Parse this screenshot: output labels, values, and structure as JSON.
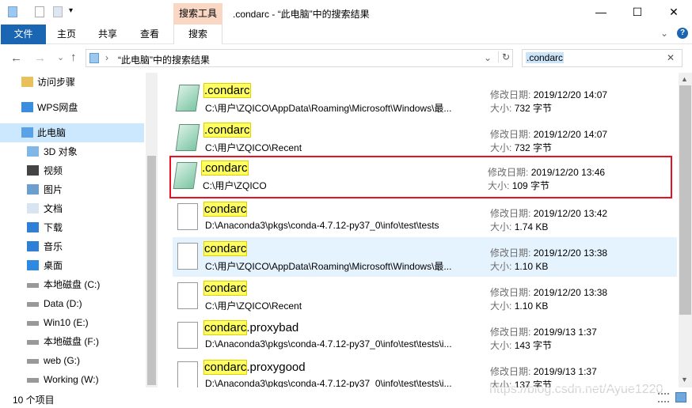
{
  "window": {
    "title": ".condarc - “此电脑”中的搜索结果",
    "context_tab": "搜索工具",
    "minimize": "—",
    "maximize": "☐",
    "close": "✕"
  },
  "ribbon": {
    "tabs": [
      {
        "label": "文件"
      },
      {
        "label": "主页"
      },
      {
        "label": "共享"
      },
      {
        "label": "查看"
      },
      {
        "label": "搜索"
      }
    ],
    "expand": "⌄",
    "help": "?"
  },
  "address": {
    "path": "“此电脑”中的搜索结果",
    "separator": "›",
    "refresh": "↻",
    "dropdown": "⌄"
  },
  "search": {
    "value": ".condarc",
    "clear": "✕"
  },
  "nav": {
    "back": "←",
    "forward": "→",
    "recent": "⌄",
    "up": "↑",
    "items": [
      {
        "label": "访问步骤",
        "icon": "folder-icon"
      },
      {
        "label": "WPS网盘",
        "icon": "cloud-icon"
      },
      {
        "label": "此电脑",
        "icon": "computer-icon",
        "selected": true
      },
      {
        "label": "3D 对象",
        "icon": "cube-icon"
      },
      {
        "label": "视频",
        "icon": "video-icon"
      },
      {
        "label": "图片",
        "icon": "picture-icon"
      },
      {
        "label": "文档",
        "icon": "document-icon"
      },
      {
        "label": "下载",
        "icon": "download-icon"
      },
      {
        "label": "音乐",
        "icon": "music-icon"
      },
      {
        "label": "桌面",
        "icon": "desktop-icon"
      },
      {
        "label": "本地磁盘 (C:)",
        "icon": "drive-icon"
      },
      {
        "label": "Data (D:)",
        "icon": "drive-icon"
      },
      {
        "label": "Win10 (E:)",
        "icon": "drive-icon"
      },
      {
        "label": "本地磁盘 (F:)",
        "icon": "drive-icon"
      },
      {
        "label": "web (G:)",
        "icon": "drive-icon"
      },
      {
        "label": "Working (W:)",
        "icon": "drive-icon"
      }
    ]
  },
  "labels": {
    "date": "修改日期:",
    "size": "大小:"
  },
  "results": [
    {
      "match": ".condarc",
      "rest": "",
      "path": "C:\\用户\\ZQICO\\AppData\\Roaming\\Microsoft\\Windows\\最...",
      "date": "2019/12/20 14:07",
      "size": "732 字节",
      "icon": "notepad-icon"
    },
    {
      "match": ".condarc",
      "rest": "",
      "path": "C:\\用户\\ZQICO\\Recent",
      "date": "2019/12/20 14:07",
      "size": "732 字节",
      "icon": "notepad-icon"
    },
    {
      "match": ".condarc",
      "rest": "",
      "path": "C:\\用户\\ZQICO",
      "date": "2019/12/20 13:46",
      "size": "109 字节",
      "icon": "notepad-icon",
      "boxed": true
    },
    {
      "match": "condarc",
      "rest": "",
      "path": "D:\\Anaconda3\\pkgs\\conda-4.7.12-py37_0\\info\\test\\tests",
      "date": "2019/12/20 13:42",
      "size": "1.74 KB",
      "icon": "file-icon"
    },
    {
      "match": "condarc",
      "rest": "",
      "path": "C:\\用户\\ZQICO\\AppData\\Roaming\\Microsoft\\Windows\\最...",
      "date": "2019/12/20 13:38",
      "size": "1.10 KB",
      "icon": "file-icon",
      "hover": true
    },
    {
      "match": "condarc",
      "rest": "",
      "path": "C:\\用户\\ZQICO\\Recent",
      "date": "2019/12/20 13:38",
      "size": "1.10 KB",
      "icon": "file-icon"
    },
    {
      "match": "condarc",
      ".rest": "",
      "rest": ".proxybad",
      "path": "D:\\Anaconda3\\pkgs\\conda-4.7.12-py37_0\\info\\test\\tests\\i...",
      "date": "2019/9/13 1:37",
      "size": "143 字节",
      "icon": "file-icon"
    },
    {
      "match": "condarc",
      "rest": ".proxygood",
      "path": "D:\\Anaconda3\\pkgs\\conda-4.7.12-py37_0\\info\\test\\tests\\i...",
      "date": "2019/9/13 1:37",
      "size": "137 字节",
      "icon": "file-icon"
    }
  ],
  "status": {
    "count": "10 个项目"
  },
  "watermark": "https://blog.csdn.net/Ayue1220",
  "colors": {
    "accent": "#1a66b3",
    "highlight": "#ffff60",
    "selection_box": "#e81123",
    "hover": "#e5f3ff",
    "context_tab": "#f9d7c4"
  }
}
